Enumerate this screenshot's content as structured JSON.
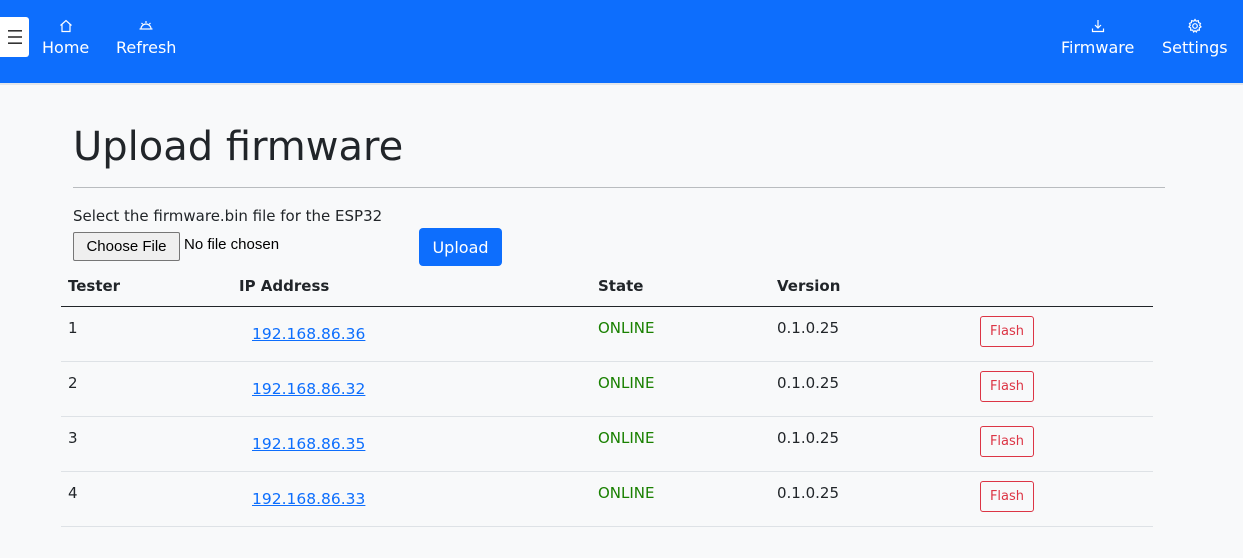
{
  "nav": {
    "home": {
      "label": "Home",
      "icon": "home-icon"
    },
    "refresh": {
      "label": "Refresh",
      "icon": "refresh-icon"
    },
    "firmware": {
      "label": "Firmware",
      "icon": "download-icon"
    },
    "settings": {
      "label": "Settings",
      "icon": "gear-icon"
    },
    "menu_icon": "hamburger-icon"
  },
  "page": {
    "title": "Upload firmware",
    "hint": "Select the firmware.bin file for the ESP32",
    "choose_file_label": "Choose File",
    "file_status": "No file chosen",
    "upload_label": "Upload"
  },
  "table": {
    "headers": [
      "Tester",
      "IP Address",
      "State",
      "Version"
    ],
    "rows": [
      {
        "tester": "1",
        "ip": "192.168.86.36",
        "state": "ONLINE",
        "version": "0.1.0.25",
        "action": "Flash"
      },
      {
        "tester": "2",
        "ip": "192.168.86.32",
        "state": "ONLINE",
        "version": "0.1.0.25",
        "action": "Flash"
      },
      {
        "tester": "3",
        "ip": "192.168.86.35",
        "state": "ONLINE",
        "version": "0.1.0.25",
        "action": "Flash"
      },
      {
        "tester": "4",
        "ip": "192.168.86.33",
        "state": "ONLINE",
        "version": "0.1.0.25",
        "action": "Flash"
      }
    ]
  },
  "colors": {
    "primary": "#0d6efd",
    "online": "#198000",
    "danger": "#dc3545",
    "background": "#f8f9fa"
  }
}
